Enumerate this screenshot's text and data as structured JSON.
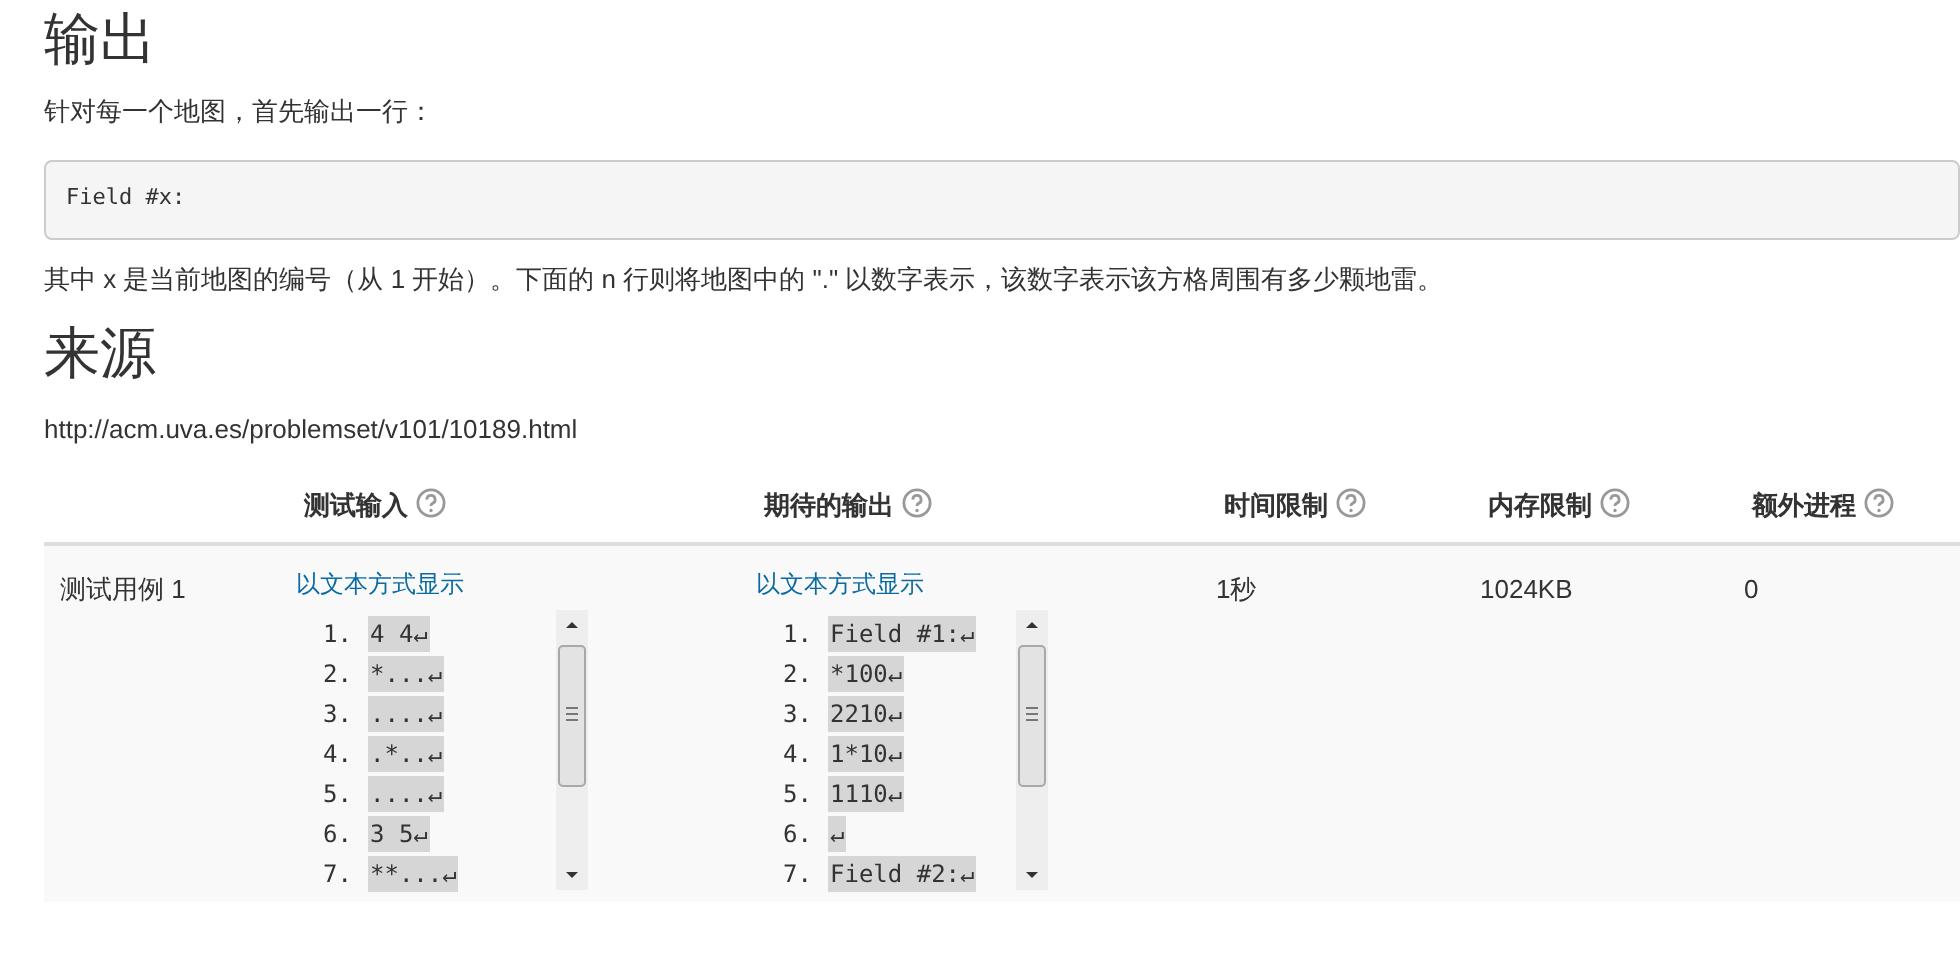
{
  "output_section": {
    "heading": "输出",
    "intro": "针对每一个地图，首先输出一行：",
    "code": "Field #x:",
    "description": "其中 x 是当前地图的编号（从 1 开始）。下面的 n 行则将地图中的 \".\" 以数字表示，该数字表示该方格周围有多少颗地雷。"
  },
  "source_section": {
    "heading": "来源",
    "url": "http://acm.uva.es/problemset/v101/10189.html"
  },
  "table": {
    "columns": [
      "",
      "测试输入",
      "期待的输出",
      "时间限制",
      "内存限制",
      "额外进程"
    ],
    "rows": [
      {
        "name": "测试用例 1",
        "input": {
          "link": "以文本方式显示",
          "lines": [
            {
              "number": "1.",
              "text": "4 4↵"
            },
            {
              "number": "2.",
              "text": "*...↵"
            },
            {
              "number": "3.",
              "text": "....↵"
            },
            {
              "number": "4.",
              "text": ".*..↵"
            },
            {
              "number": "5.",
              "text": "....↵"
            },
            {
              "number": "6.",
              "text": "3 5↵"
            },
            {
              "number": "7.",
              "text": "**...↵"
            }
          ]
        },
        "expected": {
          "link": "以文本方式显示",
          "lines": [
            {
              "number": "1.",
              "text": "Field #1:↵"
            },
            {
              "number": "2.",
              "text": "*100↵"
            },
            {
              "number": "3.",
              "text": "2210↵"
            },
            {
              "number": "4.",
              "text": "1*10↵"
            },
            {
              "number": "5.",
              "text": "1110↵"
            },
            {
              "number": "6.",
              "text": "↵"
            },
            {
              "number": "7.",
              "text": "Field #2:↵"
            }
          ]
        },
        "time": "1秒",
        "memory": "1024KB",
        "processes": "0"
      }
    ]
  }
}
